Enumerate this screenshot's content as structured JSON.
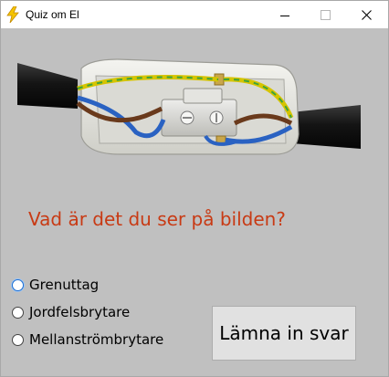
{
  "window": {
    "title": "Quiz om El",
    "icon": "lightning-icon"
  },
  "colors": {
    "question": "#c83a14",
    "background": "#c0c0c0"
  },
  "quiz": {
    "image": "photo-of-opened-inline-cord-switch",
    "question": "Vad är det du ser på bilden?",
    "options": [
      {
        "label": "Grenuttag",
        "selected": false
      },
      {
        "label": "Jordfelsbrytare",
        "selected": false
      },
      {
        "label": "Mellanströmbrytare",
        "selected": false
      }
    ],
    "submit_label": "Lämna in svar"
  }
}
